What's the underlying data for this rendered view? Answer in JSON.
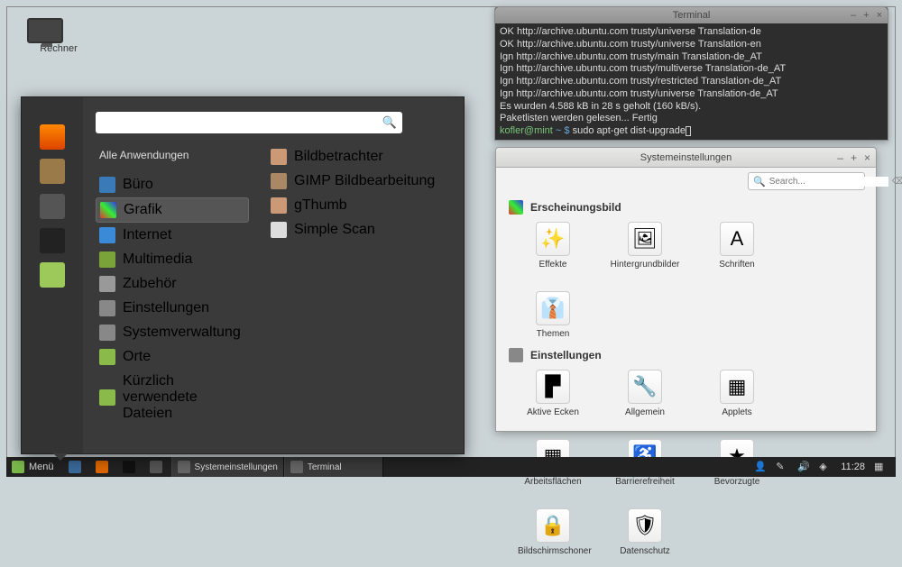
{
  "desktop": {
    "computer_label": "Rechner"
  },
  "quicklaunch": [
    {
      "name": "firefox",
      "bg": "linear-gradient(#f80,#d40)"
    },
    {
      "name": "package-manager",
      "bg": "#9b7a4a"
    },
    {
      "name": "file-manager",
      "bg": "#555"
    },
    {
      "name": "terminal",
      "bg": "#222"
    },
    {
      "name": "files",
      "bg": "#9cc95a"
    },
    {
      "name": "separator",
      "bg": "transparent"
    },
    {
      "name": "settings-1",
      "bg": "#333"
    },
    {
      "name": "settings-2",
      "bg": "#333"
    },
    {
      "name": "settings-3",
      "bg": "#333"
    }
  ],
  "menu": {
    "search_placeholder": "",
    "all_apps": "Alle Anwendungen",
    "categories": [
      {
        "label": "Büro",
        "icon": "#3a7ab8"
      },
      {
        "label": "Grafik",
        "icon": "linear-gradient(45deg,#e33,#3e3,#33e)",
        "selected": true
      },
      {
        "label": "Internet",
        "icon": "#3a8ad8"
      },
      {
        "label": "Multimedia",
        "icon": "#7aa33a"
      },
      {
        "label": "Zubehör",
        "icon": "#999"
      },
      {
        "label": "Einstellungen",
        "icon": "#888"
      },
      {
        "label": "Systemverwaltung",
        "icon": "#888"
      },
      {
        "label": "Orte",
        "icon": "#8aba4a"
      },
      {
        "label": "Kürzlich verwendete Dateien",
        "icon": "#8aba4a"
      }
    ],
    "apps": [
      {
        "label": "Bildbetrachter",
        "icon": "#c97"
      },
      {
        "label": "GIMP Bildbearbeitung",
        "icon": "#a86"
      },
      {
        "label": "gThumb",
        "icon": "#c97"
      },
      {
        "label": "Simple Scan",
        "icon": "#ddd"
      }
    ]
  },
  "terminal": {
    "title": "Terminal",
    "lines": [
      {
        "p": "OK   ",
        "u": "http://archive.ubuntu.com trusty/universe Translation-de"
      },
      {
        "p": "OK   ",
        "u": "http://archive.ubuntu.com trusty/universe Translation-en"
      },
      {
        "p": "Ign  ",
        "u": "http://archive.ubuntu.com trusty/main Translation-de_AT"
      },
      {
        "p": "Ign  ",
        "u": "http://archive.ubuntu.com trusty/multiverse Translation-de_AT"
      },
      {
        "p": "Ign  ",
        "u": "http://archive.ubuntu.com trusty/restricted Translation-de_AT"
      },
      {
        "p": "Ign  ",
        "u": "http://archive.ubuntu.com trusty/universe Translation-de_AT"
      }
    ],
    "status1": "Es wurden 4.588 kB in 28 s geholt (160 kB/s).",
    "status2": "Paketlisten werden gelesen... Fertig",
    "prompt_user": "kofler@mint",
    "prompt_path": " ~ $ ",
    "cmd": "sudo apt-get dist-upgrade"
  },
  "settings": {
    "title": "Systemeinstellungen",
    "search_placeholder": "Search...",
    "group1": "Erscheinungsbild",
    "group1_items": [
      {
        "label": "Effekte",
        "emoji": "✨"
      },
      {
        "label": "Hintergrundbilder",
        "emoji": "🖼"
      },
      {
        "label": "Schriften",
        "emoji": "A"
      },
      {
        "label": "Themen",
        "emoji": "👔"
      }
    ],
    "group2": "Einstellungen",
    "group2_items": [
      {
        "label": "Aktive Ecken",
        "emoji": "▛"
      },
      {
        "label": "Allgemein",
        "emoji": "🔧"
      },
      {
        "label": "Applets",
        "emoji": "▦"
      },
      {
        "label": "Arbeitsflächen",
        "emoji": "▦"
      },
      {
        "label": "Barrierefreiheit",
        "emoji": "♿"
      },
      {
        "label": "Bevorzugte",
        "emoji": "★"
      },
      {
        "label": "Bildschirmschoner",
        "emoji": "🔒"
      },
      {
        "label": "Datenschutz",
        "emoji": "🛡"
      }
    ]
  },
  "panel": {
    "menu_label": "Menü",
    "tasks": [
      {
        "label": "Systemeinstellungen"
      },
      {
        "label": "Terminal"
      }
    ],
    "clock": "11:28"
  }
}
